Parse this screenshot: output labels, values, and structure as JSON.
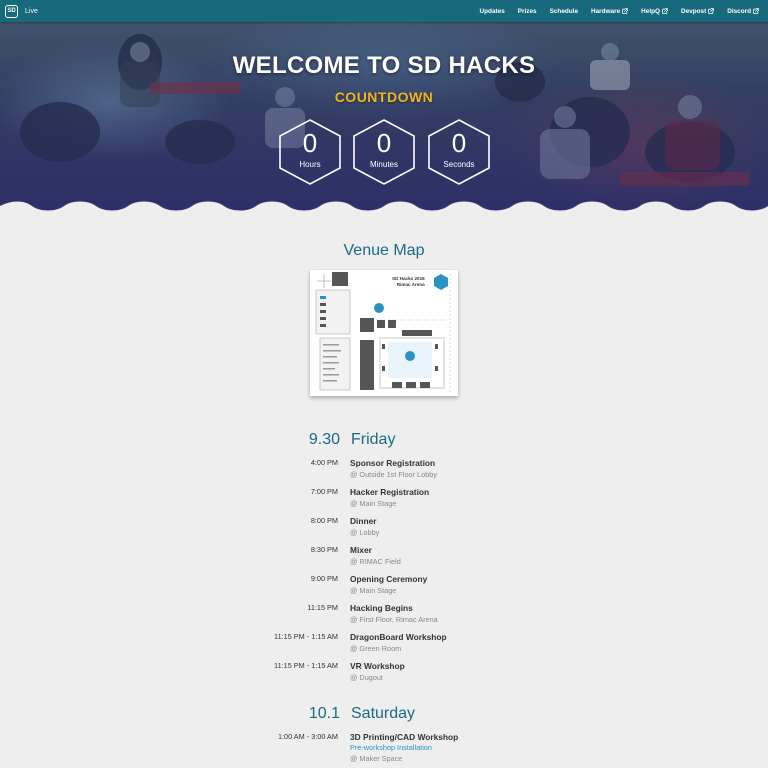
{
  "navbar": {
    "brand_logo": "SD",
    "brand_label": "Live",
    "links": [
      {
        "label": "Updates",
        "external": false
      },
      {
        "label": "Prizes",
        "external": false
      },
      {
        "label": "Schedule",
        "external": false
      },
      {
        "label": "Hardware",
        "external": true
      },
      {
        "label": "HelpQ",
        "external": true
      },
      {
        "label": "Devpost",
        "external": true
      },
      {
        "label": "Discord",
        "external": true
      }
    ]
  },
  "hero": {
    "title": "WELCOME TO SD HACKS",
    "subtitle": "COUNTDOWN",
    "counters": [
      {
        "value": "0",
        "label": "Hours"
      },
      {
        "value": "0",
        "label": "Minutes"
      },
      {
        "value": "0",
        "label": "Seconds"
      }
    ]
  },
  "venue": {
    "title": "Venue Map",
    "map_caption_line1": "SD Hacks 2016",
    "map_caption_line2": "Rimac Arena",
    "map_badge": "SD"
  },
  "schedule": [
    {
      "date": "9.30",
      "day": "Friday",
      "events": [
        {
          "time": "4:00 PM",
          "name": "Sponsor Registration",
          "location": "@ Outside 1st Floor Lobby"
        },
        {
          "time": "7:00 PM",
          "name": "Hacker Registration",
          "location": "@ Main Stage"
        },
        {
          "time": "8:00 PM",
          "name": "Dinner",
          "location": "@ Lobby"
        },
        {
          "time": "8:30 PM",
          "name": "Mixer",
          "location": "@ RIMAC Field"
        },
        {
          "time": "9:00 PM",
          "name": "Opening Ceremony",
          "location": "@ Main Stage"
        },
        {
          "time": "11:15 PM",
          "name": "Hacking Begins",
          "location": "@ First Floor, Rimac Arena"
        },
        {
          "time": "11:15 PM - 1:15 AM",
          "name": "DragonBoard Workshop",
          "location": "@ Green Room"
        },
        {
          "time": "11:15 PM - 1:15 AM",
          "name": "VR Workshop",
          "location": "@ Dugout"
        }
      ]
    },
    {
      "date": "10.1",
      "day": "Saturday",
      "events": [
        {
          "time": "1:00 AM - 3:00 AM",
          "name": "3D Printing/CAD Workshop",
          "link": "Pre-workshop Installation",
          "location": "@ Maker Space"
        }
      ]
    }
  ],
  "colors": {
    "navbar": "#176a7c",
    "accent": "#1a6b82",
    "countdown": "#f3b51e",
    "link": "#2a93c4",
    "background": "#eeeeee"
  },
  "icons": {
    "brand": "sd-logo-icon",
    "external": "external-link-icon"
  }
}
